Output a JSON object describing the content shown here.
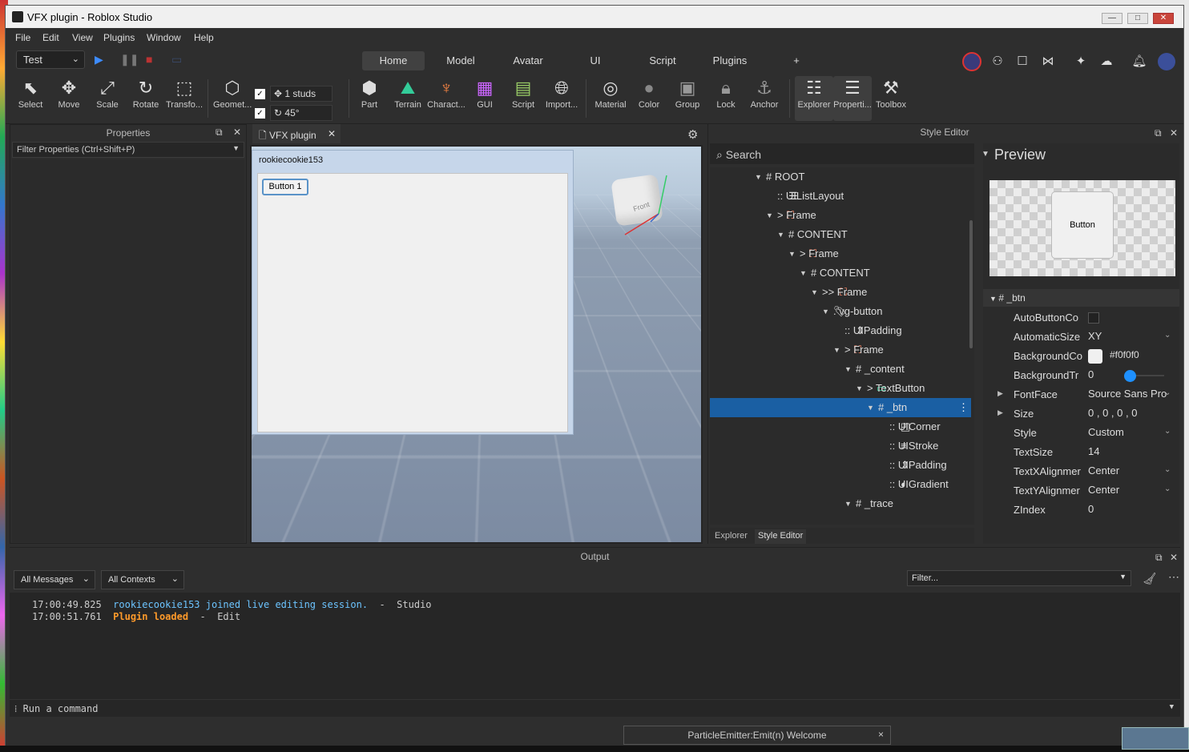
{
  "window": {
    "title": "VFX plugin - Roblox Studio",
    "controls": {
      "minimize": "—",
      "maximize": "□",
      "close": "✕"
    }
  },
  "menu": [
    "File",
    "Edit",
    "View",
    "Plugins",
    "Window",
    "Help"
  ],
  "toolbar_top": {
    "test_select": "Test",
    "tabs": [
      "Home",
      "Model",
      "Avatar",
      "UI",
      "Script",
      "Plugins"
    ],
    "add_tab": "+",
    "active_tab": "Home"
  },
  "ribbon": {
    "tools": [
      "Select",
      "Move",
      "Scale",
      "Rotate",
      "Transfo..."
    ],
    "geometry": "Geomet...",
    "snap_move": "1 studs",
    "snap_rotate": "45°",
    "insert": [
      "Part",
      "Terrain",
      "Charact...",
      "GUI",
      "Script",
      "Import..."
    ],
    "edit": [
      "Material",
      "Color",
      "Group",
      "Lock",
      "Anchor"
    ],
    "panels": [
      "Explorer",
      "Properti...",
      "Toolbox"
    ]
  },
  "properties": {
    "title": "Properties",
    "filter_placeholder": "Filter Properties (Ctrl+Shift+P)"
  },
  "viewport": {
    "tab_label": "VFX plugin",
    "gui_title": "rookiecookie153",
    "gui_button": "Button 1",
    "cube_label": "Front"
  },
  "style_editor": {
    "title": "Style Editor",
    "search_placeholder": "Search",
    "tree": [
      {
        "label": "# ROOT",
        "indent": 0,
        "arrow": "▼",
        "icon": ""
      },
      {
        "label": ":: UIListLayout",
        "indent": 1,
        "arrow": "",
        "icon": "list"
      },
      {
        "label": "> Frame",
        "indent": 1,
        "arrow": "▼",
        "icon": "frame"
      },
      {
        "label": "# CONTENT",
        "indent": 2,
        "arrow": "▼",
        "icon": ""
      },
      {
        "label": "> Frame",
        "indent": 3,
        "arrow": "▼",
        "icon": "frame"
      },
      {
        "label": "# CONTENT",
        "indent": 4,
        "arrow": "▼",
        "icon": ""
      },
      {
        "label": ">> Frame",
        "indent": 5,
        "arrow": "▼",
        "icon": "frame"
      },
      {
        "label": ". vg-button",
        "indent": 6,
        "arrow": "▼",
        "icon": "tag"
      },
      {
        "label": ":: UIPadding",
        "indent": 7,
        "arrow": "",
        "icon": "padding"
      },
      {
        "label": "> Frame",
        "indent": 7,
        "arrow": "▼",
        "icon": "frame"
      },
      {
        "label": "# _content",
        "indent": 8,
        "arrow": "▼",
        "icon": ""
      },
      {
        "label": "> TextButton",
        "indent": 9,
        "arrow": "▼",
        "icon": "textbutton"
      },
      {
        "label": "# _btn",
        "indent": 10,
        "arrow": "▼",
        "icon": "",
        "selected": true
      },
      {
        "label": ":: UICorner",
        "indent": 11,
        "arrow": "",
        "icon": "corner"
      },
      {
        "label": ":: UIStroke",
        "indent": 11,
        "arrow": "",
        "icon": "stroke"
      },
      {
        "label": ":: UIPadding",
        "indent": 11,
        "arrow": "",
        "icon": "padding"
      },
      {
        "label": ":: UIGradient",
        "indent": 11,
        "arrow": "",
        "icon": "gradient"
      },
      {
        "label": "# _trace",
        "indent": 8,
        "arrow": "▼",
        "icon": ""
      }
    ],
    "tabs": [
      "Explorer",
      "Style Editor"
    ],
    "active_tab": "Style Editor",
    "preview": {
      "title": "Preview",
      "button_label": "Button",
      "section": "# _btn",
      "properties": [
        {
          "name": "AutoButtonCo",
          "value": "",
          "kind": "checkbox"
        },
        {
          "name": "AutomaticSize",
          "value": "XY",
          "kind": "dropdown"
        },
        {
          "name": "BackgroundCo",
          "value": "#f0f0f0",
          "kind": "color"
        },
        {
          "name": "BackgroundTr",
          "value": "0",
          "kind": "slider",
          "level": 0
        },
        {
          "name": "FontFace",
          "value": "Source Sans Pro",
          "kind": "dropdown",
          "expand": true
        },
        {
          "name": "Size",
          "value": "0 , 0 , 0 , 0",
          "kind": "text",
          "expand": true
        },
        {
          "name": "Style",
          "value": "Custom",
          "kind": "dropdown"
        },
        {
          "name": "TextSize",
          "value": "14",
          "kind": "text"
        },
        {
          "name": "TextXAlignmer",
          "value": "Center",
          "kind": "dropdown"
        },
        {
          "name": "TextYAlignmer",
          "value": "Center",
          "kind": "dropdown"
        },
        {
          "name": "ZIndex",
          "value": "0",
          "kind": "text"
        }
      ]
    }
  },
  "output": {
    "title": "Output",
    "filter_messages": "All Messages",
    "filter_contexts": "All Contexts",
    "filter_placeholder": "Filter...",
    "lines": [
      {
        "time": "17:00:49.825",
        "message": "rookiecookie153 joined live editing session.",
        "suffix": "  -  Studio",
        "style": "blue"
      },
      {
        "time": "17:00:51.761",
        "message": "Plugin loaded",
        "suffix": "  -  Edit",
        "style": "orange"
      }
    ]
  },
  "command_bar": {
    "placeholder": "Run a command"
  },
  "toast": {
    "text": "ParticleEmitter:Emit(n) Welcome",
    "close": "×"
  },
  "colors": {
    "selection": "#1a5fa3",
    "accent_blue": "#6cc4ff",
    "accent_orange": "#ff9a2a",
    "slider_knob": "#1e90ff"
  }
}
